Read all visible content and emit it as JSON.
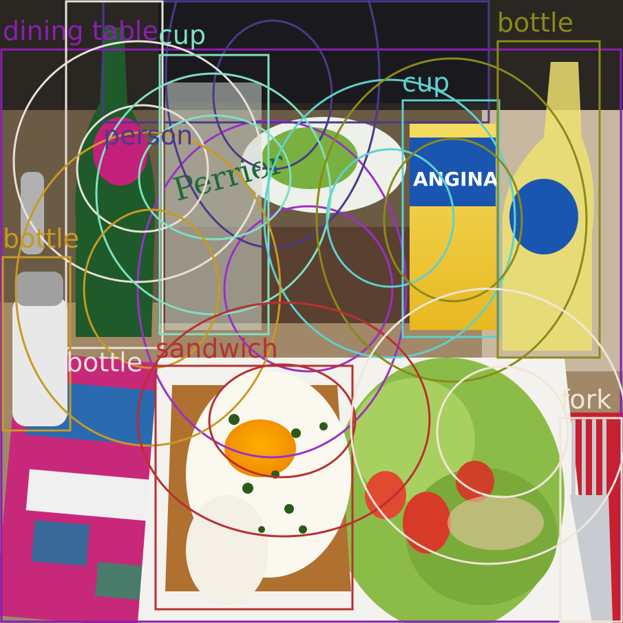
{
  "image": {
    "description_icon": "photo-of-restaurant-table-with-croque-madame-salad-and-drinks"
  },
  "detections": [
    {
      "id": "dining-table",
      "label": "dining table",
      "color": "#8a1fb0"
    },
    {
      "id": "cup-1",
      "label": "cup",
      "color": "#7fe0c0"
    },
    {
      "id": "cup-2",
      "label": "cup",
      "color": "#5fd0d0"
    },
    {
      "id": "bottle-1",
      "label": "bottle",
      "color": "#8a8a18"
    },
    {
      "id": "bottle-2",
      "label": "bottle",
      "color": "#c89a20"
    },
    {
      "id": "bottle-3",
      "label": "bottle",
      "color": "#e8e0d8"
    },
    {
      "id": "person",
      "label": "person",
      "color": "#4a3a8a"
    },
    {
      "id": "sandwich",
      "label": "sandwich",
      "color": "#b83030"
    },
    {
      "id": "fork",
      "label": "fork",
      "color": "#f0e6d8"
    }
  ]
}
